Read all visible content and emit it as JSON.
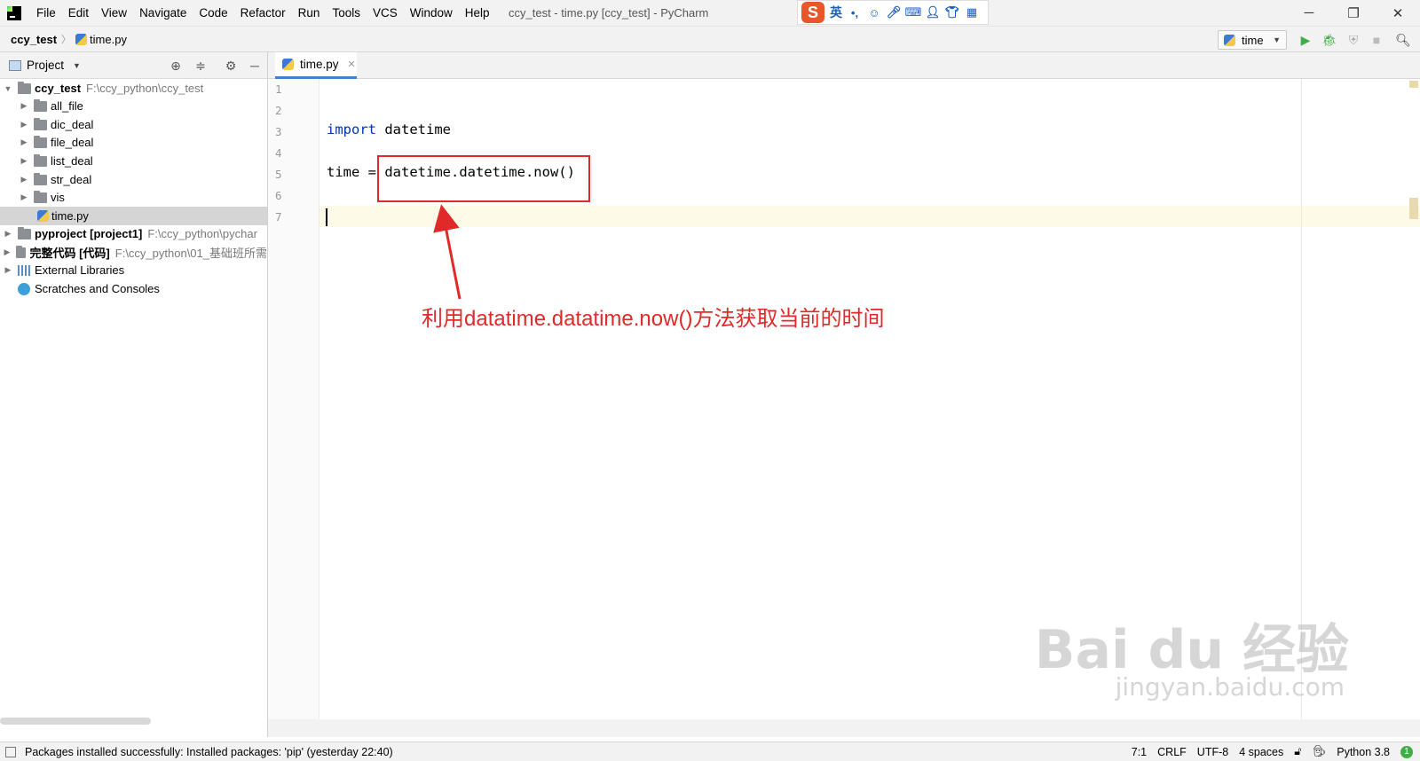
{
  "menubar": {
    "items": [
      "File",
      "Edit",
      "View",
      "Navigate",
      "Code",
      "Refactor",
      "Run",
      "Tools",
      "VCS",
      "Window",
      "Help"
    ],
    "window_title": "ccy_test - time.py [ccy_test] - PyCharm",
    "ime_logo": "S",
    "ime_lang": "英",
    "ime_punct": "•,"
  },
  "window_controls": {
    "minimize": "─",
    "restore": "❐",
    "close": "✕"
  },
  "navbar": {
    "root": "ccy_test",
    "file": "time.py",
    "run_config": "time"
  },
  "project_panel": {
    "title": "Project",
    "tree": [
      {
        "label": "ccy_test",
        "path": "F:\\ccy_python\\ccy_test"
      },
      {
        "label": "all_file"
      },
      {
        "label": "dic_deal"
      },
      {
        "label": "file_deal"
      },
      {
        "label": "list_deal"
      },
      {
        "label": "str_deal"
      },
      {
        "label": "vis"
      },
      {
        "label": "time.py"
      },
      {
        "label": "pyproject [project1]",
        "path": "F:\\ccy_python\\pychar"
      },
      {
        "label": "完整代码 [代码]",
        "path": "F:\\ccy_python\\01_基础班所需"
      },
      {
        "label": "External Libraries"
      },
      {
        "label": "Scratches and Consoles"
      }
    ]
  },
  "editor": {
    "tab_label": "time.py",
    "line_numbers": [
      "1",
      "2",
      "3",
      "4",
      "5",
      "6",
      "7"
    ],
    "code": {
      "line3_kw": "import",
      "line3_rest": " datetime",
      "line5_lhs": "time = ",
      "line5_rhs": "datetime.datetime.now()"
    },
    "annotation": "利用datatime.datatime.now()方法获取当前的时间",
    "accent_color": "#e02a2a"
  },
  "watermark": {
    "main": "Bai du 经验",
    "sub": "jingyan.baidu.com"
  },
  "statusbar": {
    "message": "Packages installed successfully: Installed packages: 'pip' (yesterday 22:40)",
    "position": "7:1",
    "line_sep": "CRLF",
    "encoding": "UTF-8",
    "indent": "4 spaces",
    "interpreter": "Python 3.8",
    "notifications": "1"
  }
}
